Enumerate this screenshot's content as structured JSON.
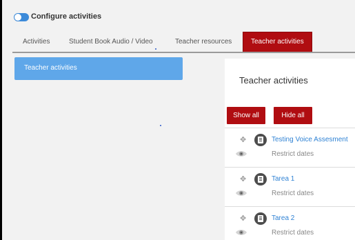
{
  "header": {
    "title": "Configure activities"
  },
  "tabs": [
    {
      "label": "Activities"
    },
    {
      "label": "Student Book Audio / Video"
    },
    {
      "label": "Teacher resources"
    },
    {
      "label": "Teacher activities"
    }
  ],
  "sidebar": {
    "items": [
      {
        "label": "Teacher activities"
      }
    ]
  },
  "panel": {
    "title": "Teacher activities",
    "show_all_label": "Show all",
    "hide_all_label": "Hide all",
    "activities": [
      {
        "name": "Testing Voice Assesment",
        "restrict": "Restrict dates"
      },
      {
        "name": "Tarea 1",
        "restrict": "Restrict dates"
      },
      {
        "name": "Tarea 2",
        "restrict": "Restrict dates"
      }
    ]
  },
  "colors": {
    "accent_red": "#b00d11",
    "sidebar_blue": "#5fa7e9",
    "link_blue": "#2f82d4",
    "toggle_blue": "#3c8ad9"
  },
  "icons": [
    "toggle-switch-icon",
    "move-icon",
    "activity-type-icon",
    "eye-icon"
  ]
}
